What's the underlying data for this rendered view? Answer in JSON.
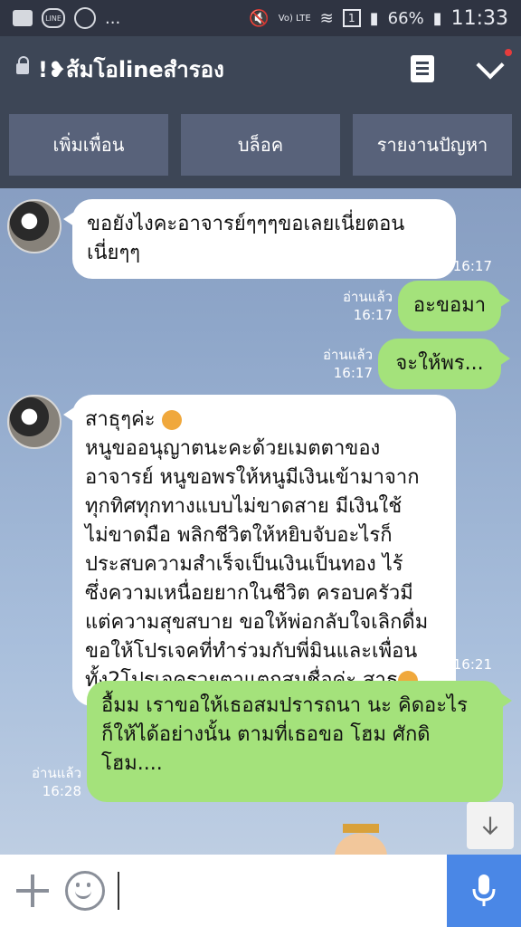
{
  "status_bar": {
    "left_icons": [
      "image-icon",
      "line-app-icon",
      "cloud-icon",
      "more-icon"
    ],
    "more_text": "...",
    "network_label": "Vo) LTE",
    "sim_slot": "1",
    "battery": "66%",
    "time": "11:33"
  },
  "header": {
    "title": "!❥ส้มโอlineสำรอง"
  },
  "actions": {
    "add_friend": "เพิ่มเพื่อน",
    "block": "บล็อค",
    "report": "รายงานปัญหา"
  },
  "messages": [
    {
      "side": "in",
      "text": "ขอยังไงคะอาจารย์ๆๆๆขอเลยเนี่ยตอนเนี่ยๆๆ",
      "time": "16:17"
    },
    {
      "side": "out",
      "text": "อะขอมา",
      "read": "อ่านแล้ว",
      "time": "16:17"
    },
    {
      "side": "out",
      "text": "จะให้พร...",
      "read": "อ่านแล้ว",
      "time": "16:17"
    },
    {
      "side": "in",
      "text_lines": [
        "สาธุๆค่ะ",
        "หนูขออนุญาตนะคะด้วยเมตตาของ",
        "อาจารย์ หนูขอพรให้หนูมีเงินเข้ามาจาก",
        "ทุกทิศทุกทางแบบไม่ขาดสาย มีเงินใช้",
        "ไม่ขาดมือ พลิกชีวิตให้หยิบจับอะไรก็",
        "ประสบความสำเร็จเป็นเงินเป็นทอง ไร้",
        "ซึ่งความเหนื่อยยากในชีวิต ครอบครัวมี",
        "แต่ความสุขสบาย ขอให้พ่อกลับใจเลิกดื่ม",
        "ขอให้โปรเจคที่ทำร่วมกับพี่มินและเพื่อน",
        "ทั้ง2โปรเจครวยตาแตกสมชื่อค่ะ สาธุ"
      ],
      "time": "16:21"
    },
    {
      "side": "out",
      "text_lines": [
        "อื้มม เราขอให้เธอสมปรารถนา นะ คิดอะไร",
        "ก็ให้ได้อย่างนั้น ตามที่เธอขอ โฮม ศักดิ",
        "โฮม...."
      ],
      "read": "อ่านแล้ว",
      "time": "16:28"
    }
  ],
  "input": {
    "placeholder": ""
  }
}
